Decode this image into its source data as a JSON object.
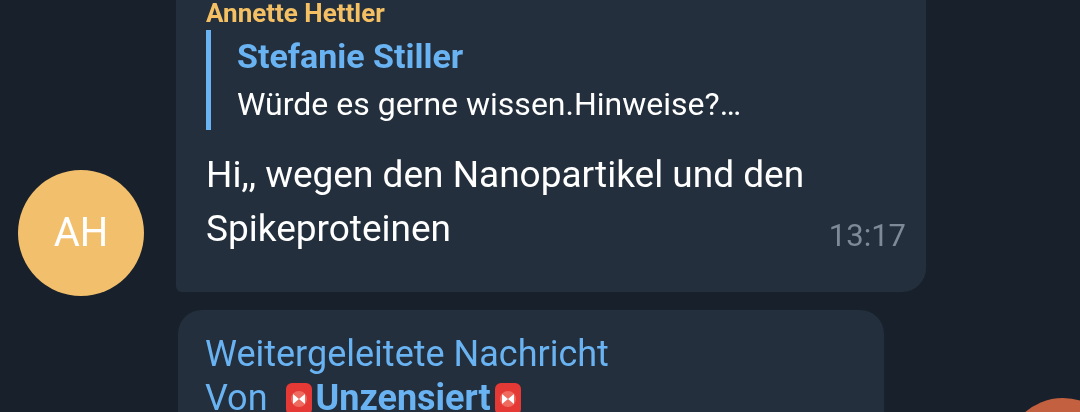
{
  "message": {
    "sender": "Annette Hettler",
    "reply": {
      "author": "Stefanie Stiller",
      "text": "Würde es gerne wissen.Hinweise?…"
    },
    "text": "Hi,, wegen den Nanopartikel und den Spikeproteinen",
    "time": "13:17",
    "avatar": {
      "initials": "AH",
      "color": "#f2bf6c"
    }
  },
  "forwarded": {
    "label": "Weitergeleitete Nachricht",
    "from_prefix": "Von",
    "from_name": "Unzensiert"
  }
}
